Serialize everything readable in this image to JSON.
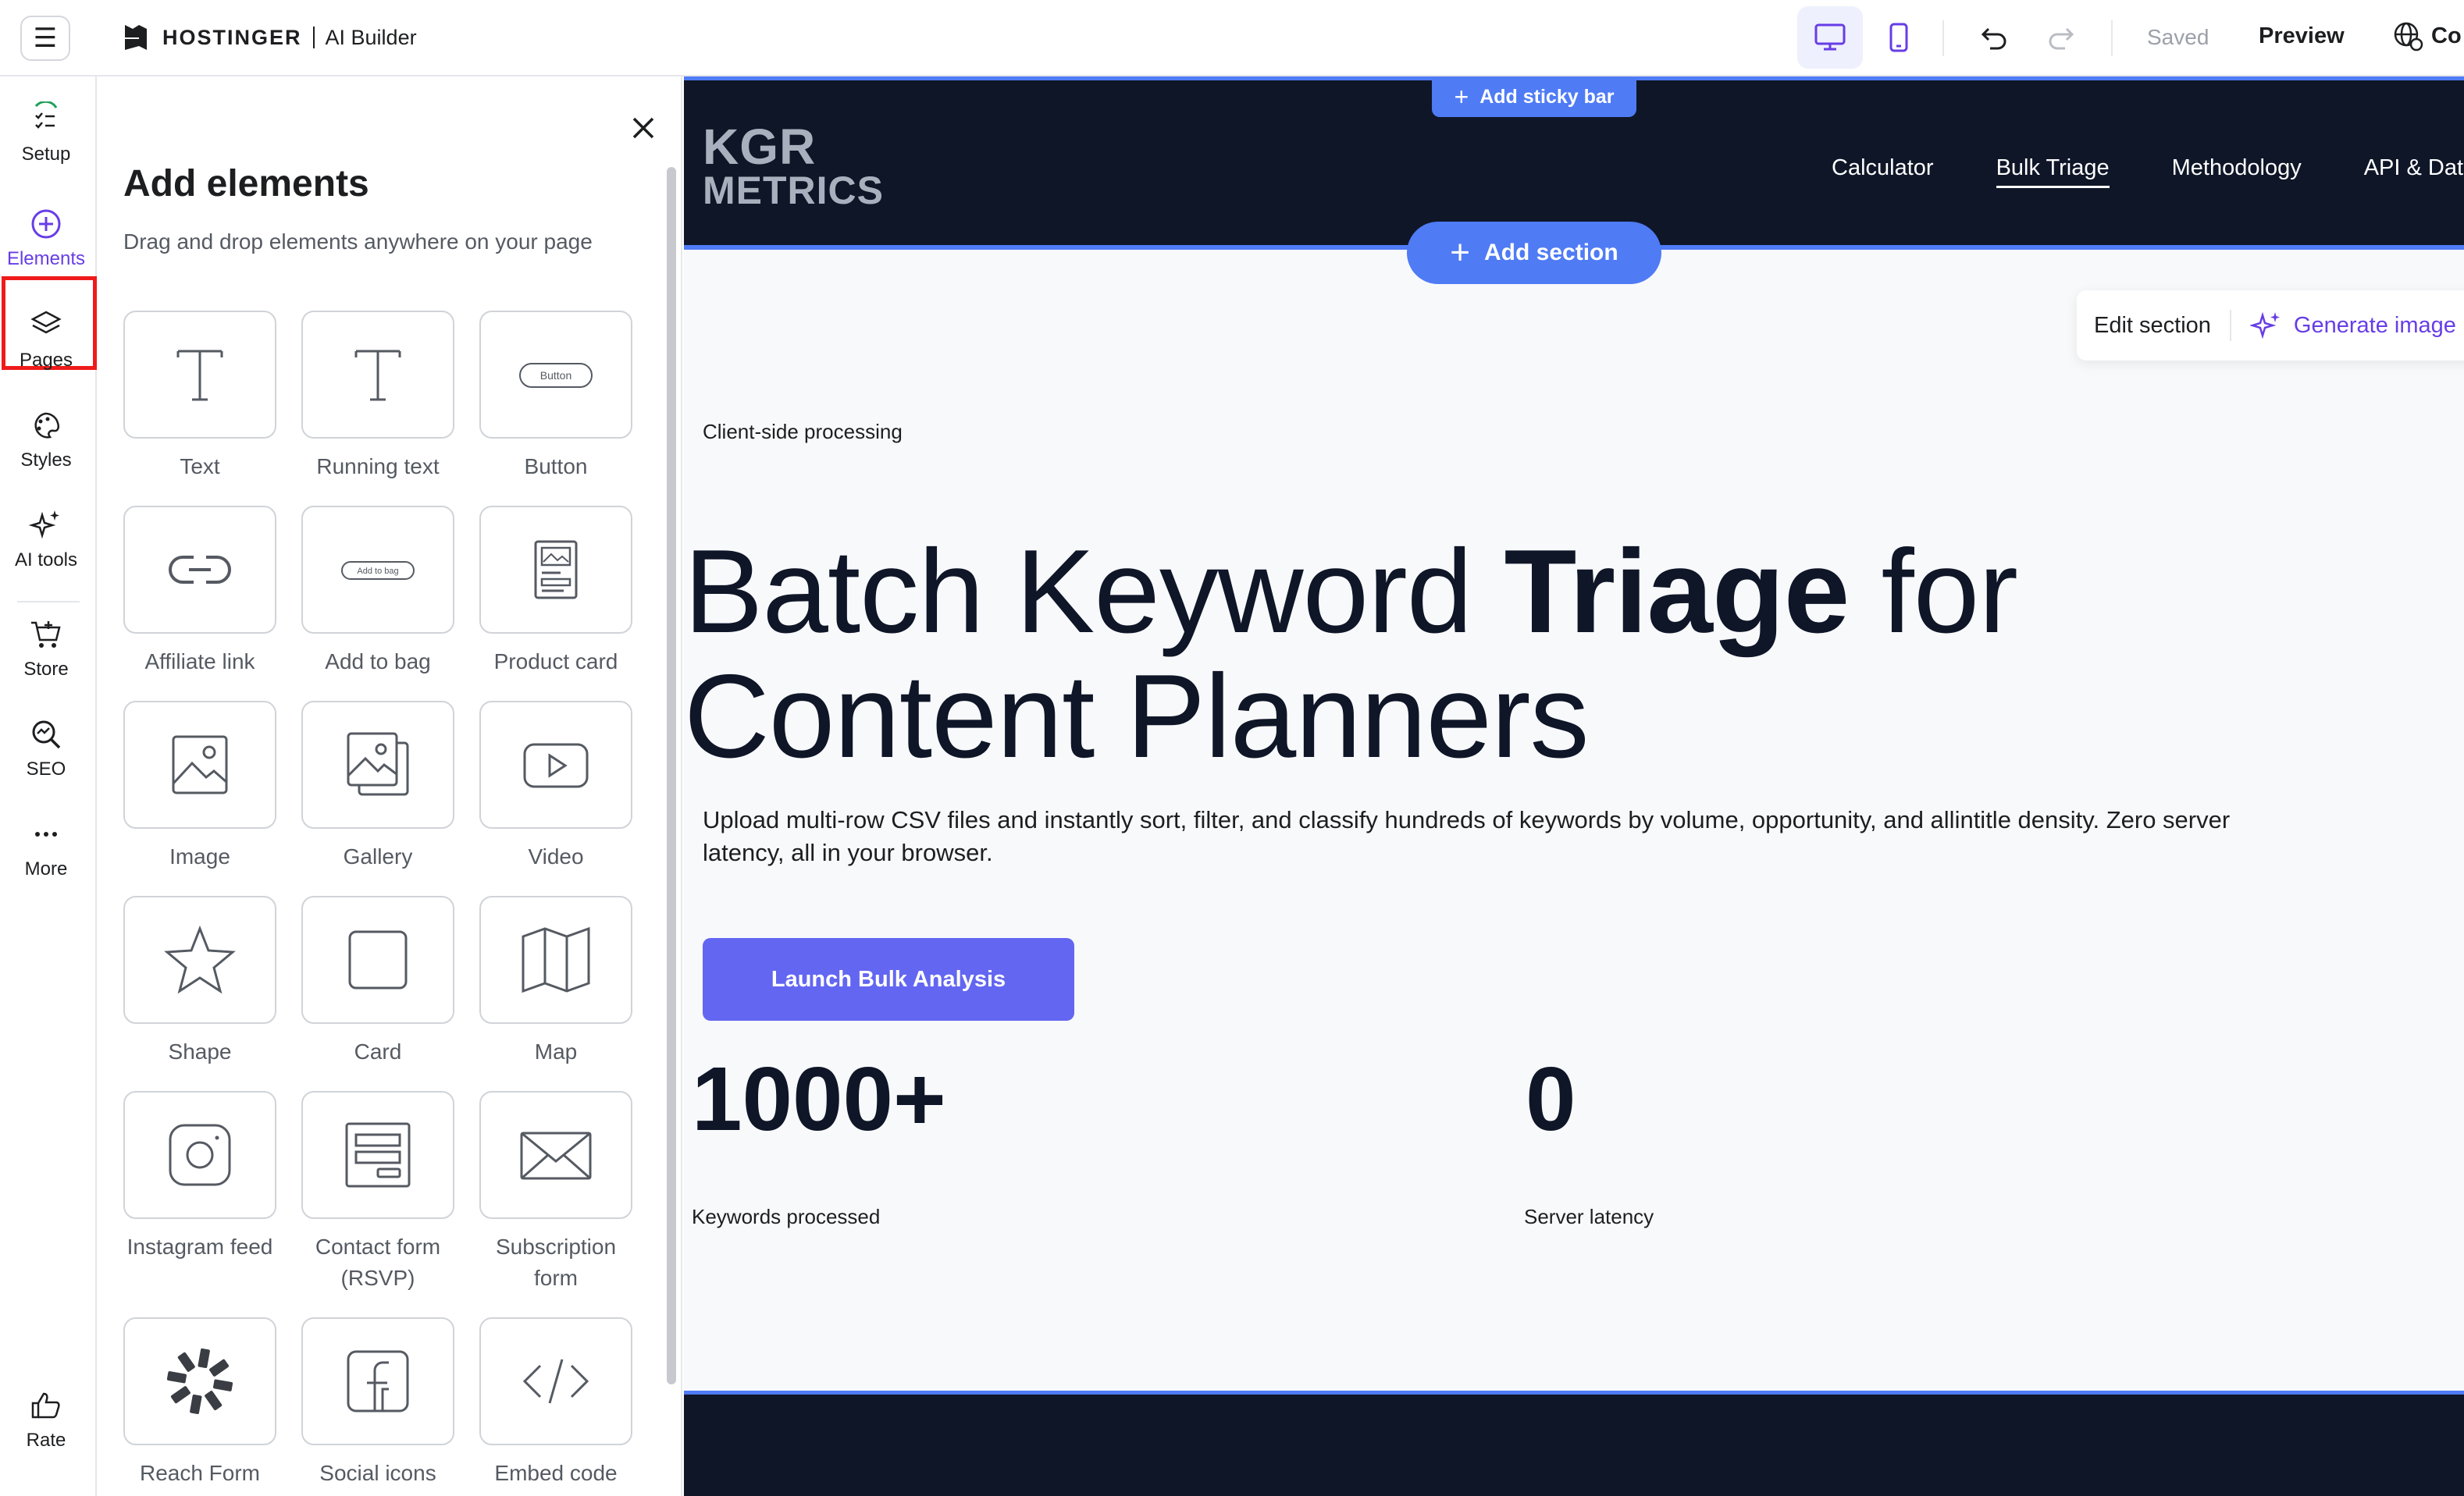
{
  "topbar": {
    "brand_name": "HOSTINGER",
    "brand_sub": "AI Builder",
    "saved": "Saved",
    "preview": "Preview",
    "connect": "Co"
  },
  "rail": {
    "setup": "Setup",
    "elements": "Elements",
    "pages": "Pages",
    "styles": "Styles",
    "ai_tools": "AI tools",
    "store": "Store",
    "seo": "SEO",
    "more": "More",
    "rate": "Rate"
  },
  "panel": {
    "title": "Add elements",
    "subtitle": "Drag and drop elements anywhere on your page",
    "tiles": [
      {
        "label": "Text",
        "icon": "text-icon"
      },
      {
        "label": "Running text",
        "icon": "running-text-icon"
      },
      {
        "label": "Button",
        "icon": "button-icon",
        "inner": "Button"
      },
      {
        "label": "Affiliate link",
        "icon": "link-icon"
      },
      {
        "label": "Add to bag",
        "icon": "add-to-bag-icon",
        "inner": "Add to bag"
      },
      {
        "label": "Product card",
        "icon": "product-card-icon"
      },
      {
        "label": "Image",
        "icon": "image-icon"
      },
      {
        "label": "Gallery",
        "icon": "gallery-icon"
      },
      {
        "label": "Video",
        "icon": "video-icon"
      },
      {
        "label": "Shape",
        "icon": "star-icon"
      },
      {
        "label": "Card",
        "icon": "card-icon"
      },
      {
        "label": "Map",
        "icon": "map-icon"
      },
      {
        "label": "Instagram feed",
        "icon": "instagram-icon"
      },
      {
        "label": "Contact form (RSVP)",
        "icon": "contact-form-icon"
      },
      {
        "label": "Subscription form",
        "icon": "envelope-icon"
      },
      {
        "label": "Reach Form",
        "icon": "reach-form-icon"
      },
      {
        "label": "Social icons",
        "icon": "facebook-icon"
      },
      {
        "label": "Embed code",
        "icon": "code-icon"
      }
    ]
  },
  "site": {
    "sticky_bar": "Add sticky bar",
    "logo_line1": "KGR",
    "logo_line2": "METRICS",
    "nav": [
      "Calculator",
      "Bulk Triage",
      "Methodology",
      "API & Data"
    ],
    "add_section": "Add section",
    "edit_section": "Edit section",
    "generate_image": "Generate image",
    "eyebrow": "Client-side processing",
    "hero_part1": "Batch Keyword ",
    "hero_bold": "Triage",
    "hero_part2": " for Content Planners",
    "hero_desc": "Upload multi-row CSV files and instantly sort, filter, and classify hundreds of keywords by volume, opportunity, and allintitle density. Zero server latency, all in your browser.",
    "cta": "Launch Bulk Analysis",
    "stats": [
      {
        "value": "1000+",
        "label": "Keywords processed"
      },
      {
        "value": "0",
        "label": "Server latency"
      }
    ]
  },
  "colors": {
    "accent": "#673de6",
    "canvas_blue": "#4f7bf5",
    "navy": "#0f1628",
    "cta": "#6366f1",
    "highlight_red": "#ef1b1b"
  }
}
